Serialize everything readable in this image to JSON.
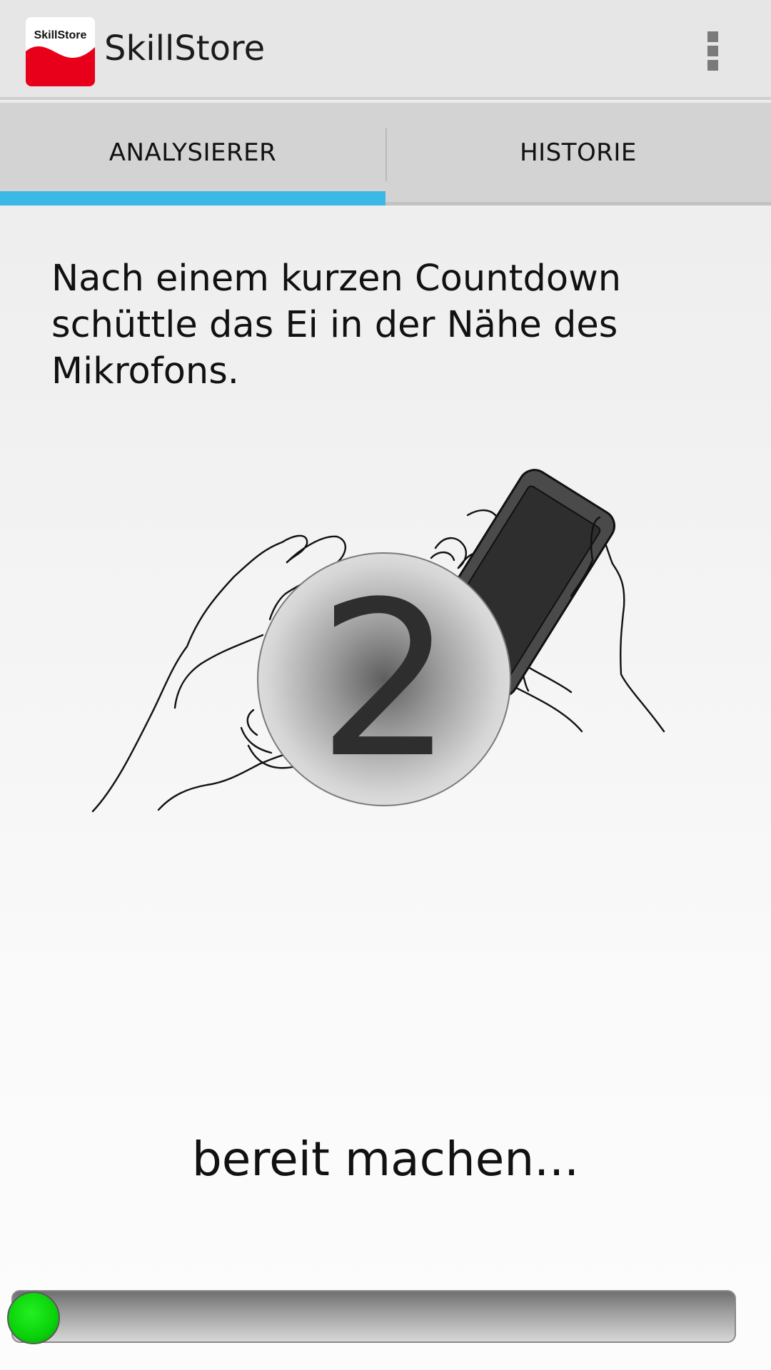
{
  "app": {
    "title": "SkillStore",
    "logo_text": "SkillStore"
  },
  "toolbar": {
    "overflow_icon": "more-vert-icon"
  },
  "tabs": [
    {
      "label": "ANALYSIERER",
      "selected": true
    },
    {
      "label": "HISTORIE",
      "selected": false
    }
  ],
  "main": {
    "instruction": "Nach einem kurzen Countdown schüttle das Ei in der Nähe des Mikrofons.",
    "countdown": "2",
    "status": "bereit machen..."
  },
  "progress": {
    "value": 0
  },
  "colors": {
    "accent": "#3cb8e6",
    "logo_red": "#e8001a",
    "knob_green": "#0ad10a"
  }
}
